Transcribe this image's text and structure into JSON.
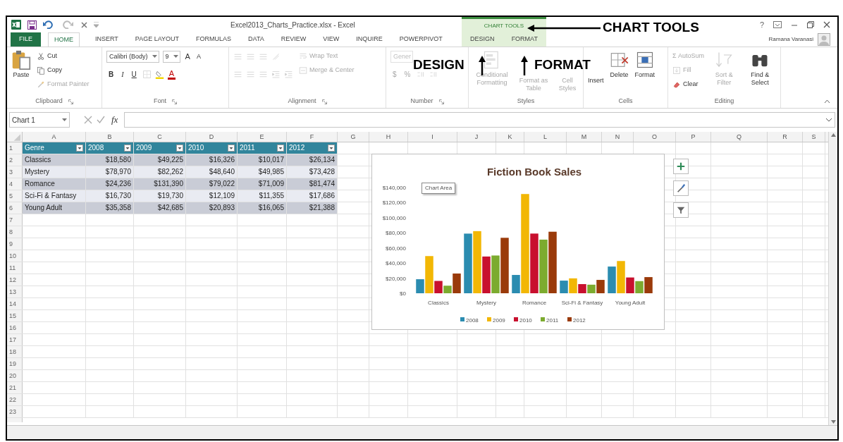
{
  "window": {
    "title": "Excel2013_Charts_Practice.xlsx - Excel",
    "help_button": "?",
    "user": "Ramana Varanasi"
  },
  "ribbon_tabs": [
    {
      "label": "FILE",
      "kind": "file",
      "selected": false
    },
    {
      "label": "HOME",
      "kind": "tab",
      "selected": true
    },
    {
      "label": "INSERT",
      "kind": "tab",
      "selected": false
    },
    {
      "label": "PAGE LAYOUT",
      "kind": "tab",
      "selected": false
    },
    {
      "label": "FORMULAS",
      "kind": "tab",
      "selected": false
    },
    {
      "label": "DATA",
      "kind": "tab",
      "selected": false
    },
    {
      "label": "REVIEW",
      "kind": "tab",
      "selected": false
    },
    {
      "label": "VIEW",
      "kind": "tab",
      "selected": false
    },
    {
      "label": "INQUIRE",
      "kind": "tab",
      "selected": false
    },
    {
      "label": "POWERPIVOT",
      "kind": "tab",
      "selected": false
    }
  ],
  "chart_tools": {
    "label": "CHART TOOLS",
    "tabs": [
      {
        "label": "DESIGN",
        "selected": false
      },
      {
        "label": "FORMAT",
        "selected": false
      }
    ]
  },
  "ribbon_groups": [
    {
      "label": "Clipboard",
      "launcher": true,
      "items": [
        {
          "kind": "paste",
          "label": "Paste",
          "disabled": false
        },
        {
          "kind": "stack",
          "entries": [
            {
              "kind": "cut",
              "label": "Cut",
              "disabled": false
            },
            {
              "kind": "copy",
              "label": "Copy",
              "disabled": false
            },
            {
              "kind": "format-painter",
              "label": "Format Painter",
              "disabled": true
            }
          ]
        }
      ]
    },
    {
      "label": "Font",
      "launcher": true,
      "items": [
        {
          "kind": "rows",
          "rows": [
            {
              "entries": [
                {
                  "kind": "font-name",
                  "value": "Calibri (Body)",
                  "disabled": false
                },
                {
                  "kind": "font-size",
                  "value": "9",
                  "disabled": false
                },
                {
                  "kind": "grow",
                  "label": "A",
                  "disabled": false
                },
                {
                  "kind": "shrink",
                  "label": "A",
                  "disabled": false
                }
              ]
            },
            {
              "entries": [
                {
                  "kind": "bold",
                  "label": "B",
                  "disabled": false
                },
                {
                  "kind": "italic",
                  "label": "I",
                  "disabled": false
                },
                {
                  "kind": "underline",
                  "label": "U",
                  "disabled": false
                },
                {
                  "kind": "borders",
                  "disabled": true
                },
                {
                  "kind": "fill-color",
                  "disabled": false
                },
                {
                  "kind": "font-color",
                  "label": "A",
                  "disabled": false
                }
              ]
            }
          ]
        }
      ]
    },
    {
      "label": "Alignment",
      "launcher": true,
      "items": [
        {
          "kind": "rows",
          "rows": [
            {
              "entries": [
                {
                  "kind": "align-top",
                  "disabled": true
                },
                {
                  "kind": "align-middle",
                  "disabled": true
                },
                {
                  "kind": "align-bottom",
                  "disabled": true
                },
                {
                  "kind": "orientation",
                  "disabled": true
                }
              ]
            },
            {
              "entries": [
                {
                  "kind": "align-left",
                  "disabled": true
                },
                {
                  "kind": "align-center",
                  "disabled": true
                },
                {
                  "kind": "align-right",
                  "disabled": true
                },
                {
                  "kind": "decrease-indent",
                  "disabled": true
                },
                {
                  "kind": "increase-indent",
                  "disabled": true
                }
              ]
            }
          ]
        },
        {
          "kind": "stack",
          "entries": [
            {
              "kind": "wrap-text",
              "label": "Wrap Text",
              "disabled": true
            },
            {
              "kind": "merge-center",
              "label": "Merge & Center",
              "disabled": true
            }
          ]
        }
      ]
    },
    {
      "label": "Number",
      "launcher": true,
      "items": [
        {
          "kind": "rows",
          "rows": [
            {
              "entries": [
                {
                  "kind": "number-format",
                  "value": "Gener",
                  "disabled": true
                }
              ]
            },
            {
              "entries": [
                {
                  "kind": "currency",
                  "label": "$",
                  "disabled": true
                },
                {
                  "kind": "percent",
                  "label": "%",
                  "disabled": true
                },
                {
                  "kind": "increase-decimal",
                  "disabled": true
                },
                {
                  "kind": "decrease-decimal",
                  "disabled": true
                }
              ]
            }
          ]
        }
      ]
    },
    {
      "label": "Styles",
      "launcher": false,
      "items": [
        {
          "kind": "conditional-formatting",
          "label": "Conditional Formatting",
          "disabled": true
        },
        {
          "kind": "format-as-table",
          "label": "Format as Table",
          "disabled": true
        },
        {
          "kind": "cell-styles",
          "label": "Cell Styles",
          "disabled": true
        }
      ]
    },
    {
      "label": "Cells",
      "launcher": false,
      "items": [
        {
          "kind": "insert",
          "label": "Insert",
          "disabled": false
        },
        {
          "kind": "delete",
          "label": "Delete",
          "disabled": false
        },
        {
          "kind": "format",
          "label": "Format",
          "disabled": false
        }
      ]
    },
    {
      "label": "Editing",
      "launcher": false,
      "items": [
        {
          "kind": "stack",
          "entries": [
            {
              "kind": "autosum",
              "label": "Σ AutoSum",
              "disabled": true
            },
            {
              "kind": "fill",
              "label": "Fill",
              "disabled": true
            },
            {
              "kind": "clear",
              "label": "Clear",
              "disabled": false
            }
          ]
        },
        {
          "kind": "sort-filter",
          "label": "Sort & Filter",
          "disabled": true
        },
        {
          "kind": "find-select",
          "label": "Find & Select",
          "disabled": false
        }
      ]
    }
  ],
  "formula_bar": {
    "name_box": "Chart 1",
    "function_label": "fx"
  },
  "sheet": {
    "columns": [
      "A",
      "B",
      "C",
      "D",
      "E",
      "F",
      "G",
      "H",
      "I",
      "J",
      "K",
      "L",
      "M",
      "N",
      "O",
      "P",
      "Q",
      "R",
      "S"
    ],
    "row_numbers": [
      "1",
      "2",
      "3",
      "4",
      "5",
      "6",
      "7",
      "8",
      "9",
      "10",
      "11",
      "12",
      "13",
      "14",
      "15",
      "16",
      "17",
      "18",
      "19",
      "20",
      "21",
      "22",
      "23"
    ],
    "table": {
      "columns": [
        "Genre",
        "2008",
        "2009",
        "2010",
        "2011",
        "2012"
      ],
      "rows": [
        [
          "Classics",
          "$18,580",
          "$49,225",
          "$16,326",
          "$10,017",
          "$26,134"
        ],
        [
          "Mystery",
          "$78,970",
          "$82,262",
          "$48,640",
          "$49,985",
          "$73,428"
        ],
        [
          "Romance",
          "$24,236",
          "$131,390",
          "$79,022",
          "$71,009",
          "$81,474"
        ],
        [
          "Sci-Fi & Fantasy",
          "$16,730",
          "$19,730",
          "$12,109",
          "$11,355",
          "$17,686"
        ],
        [
          "Young Adult",
          "$35,358",
          "$42,685",
          "$20,893",
          "$16,065",
          "$21,388"
        ]
      ]
    }
  },
  "chart": {
    "tooltip": "Chart Area",
    "chart_data": {
      "type": "bar",
      "title": "Fiction Book Sales",
      "legend": "bottom",
      "categories": [
        "Classics",
        "Mystery",
        "Romance",
        "Sci-Fi & Fantasy",
        "Young Adult"
      ],
      "series": [
        {
          "name": "2008",
          "color": "#2b8cb0",
          "values": [
            18580,
            78970,
            24236,
            16730,
            35358
          ]
        },
        {
          "name": "2009",
          "color": "#f2b705",
          "values": [
            49225,
            82262,
            131390,
            19730,
            42685
          ]
        },
        {
          "name": "2010",
          "color": "#c8102e",
          "values": [
            16326,
            48640,
            79022,
            12109,
            20893
          ]
        },
        {
          "name": "2011",
          "color": "#7cab2f",
          "values": [
            10017,
            49985,
            71009,
            11355,
            16065
          ]
        },
        {
          "name": "2012",
          "color": "#9a3a0a",
          "values": [
            26134,
            73428,
            81474,
            17686,
            21388
          ]
        }
      ],
      "ylim": [
        0,
        140000
      ],
      "yticks": [
        {
          "value": 0,
          "label": "$0"
        },
        {
          "value": 20000,
          "label": "$20,000"
        },
        {
          "value": 40000,
          "label": "$40,000"
        },
        {
          "value": 60000,
          "label": "$60,000"
        },
        {
          "value": 80000,
          "label": "$80,000"
        },
        {
          "value": 100000,
          "label": "$100,000"
        },
        {
          "value": 120000,
          "label": "$120,000"
        },
        {
          "value": 140000,
          "label": "$140,000"
        }
      ]
    }
  },
  "annotations": [
    {
      "kind": "left",
      "text": "CHART TOOLS"
    },
    {
      "kind": "up",
      "text": "DESIGN"
    },
    {
      "kind": "up",
      "text": "FORMAT"
    }
  ]
}
